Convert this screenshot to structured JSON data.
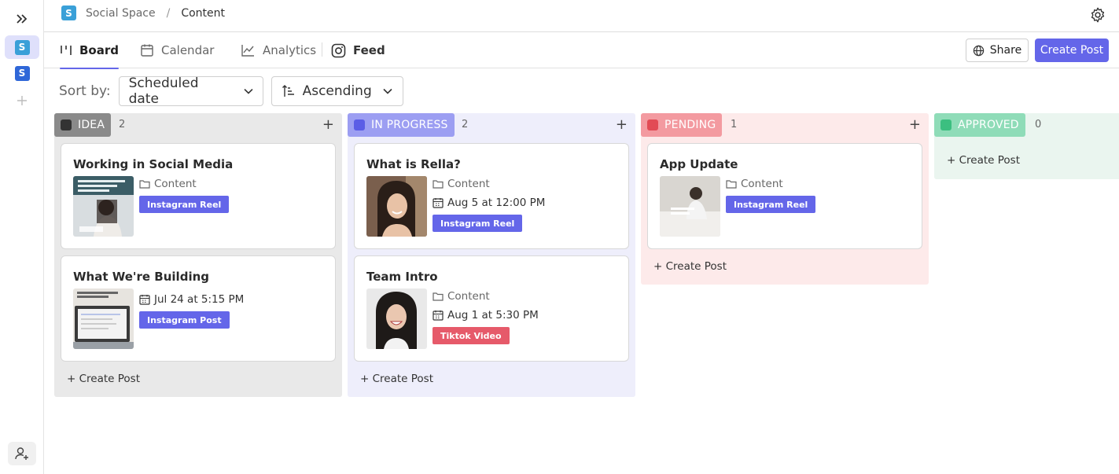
{
  "rail": {
    "workspaces": [
      {
        "letter": "S",
        "color": "#3aa0d8",
        "active": true
      },
      {
        "letter": "S",
        "color": "#2f67d8",
        "active": false
      }
    ]
  },
  "breadcrumb": {
    "workspace": "Social Space",
    "separator": "/",
    "current": "Content"
  },
  "tabs": [
    {
      "label": "Board",
      "icon": "board-icon",
      "active": true
    },
    {
      "label": "Calendar",
      "icon": "calendar-icon",
      "active": false
    },
    {
      "label": "Analytics",
      "icon": "analytics-icon",
      "active": false
    },
    {
      "label": "Feed",
      "icon": "instagram-icon",
      "active": false
    }
  ],
  "toolbar": {
    "share_label": "Share",
    "create_label": "Create Post"
  },
  "sort": {
    "label": "Sort by:",
    "field": "Scheduled date",
    "order": "Ascending"
  },
  "colors": {
    "accent": "#6466e9",
    "reel_tag": "#6466e9",
    "tiktok_tag": "#e65a6a"
  },
  "columns": [
    {
      "name": "IDEA",
      "count": "2",
      "head_color": "#8a8a8a",
      "square": "#333333",
      "bg": "#e9e9e9",
      "cards": [
        {
          "title": "Working in Social Media",
          "folder": "Content",
          "date": "",
          "tag": "Instagram Reel",
          "tag_color": "#6466e9"
        },
        {
          "title": "What We're Building",
          "folder": "",
          "date": "Jul 24 at 5:15 PM",
          "tag": "Instagram Post",
          "tag_color": "#6466e9"
        }
      ],
      "add_label": "+ Create Post"
    },
    {
      "name": "IN PROGRESS",
      "count": "2",
      "head_color": "#9c9ef2",
      "square": "#5b5de6",
      "bg": "#eeeefb",
      "cards": [
        {
          "title": "What is Rella?",
          "folder": "Content",
          "date": "Aug 5 at 12:00 PM",
          "tag": "Instagram Reel",
          "tag_color": "#6466e9"
        },
        {
          "title": "Team Intro",
          "folder": "Content",
          "date": "Aug 1 at 5:30 PM",
          "tag": "Tiktok Video",
          "tag_color": "#e65a6a"
        }
      ],
      "add_label": "+ Create Post"
    },
    {
      "name": "PENDING",
      "count": "1",
      "head_color": "#f39aa0",
      "square": "#e24b55",
      "bg": "#fdeaea",
      "cards": [
        {
          "title": "App Update",
          "folder": "Content",
          "date": "",
          "tag": "Instagram Reel",
          "tag_color": "#6466e9"
        }
      ],
      "add_label": "+ Create Post"
    },
    {
      "name": "APPROVED",
      "count": "0",
      "head_color": "#8fdcb8",
      "square": "#3cbf80",
      "bg": "#eaf5ef",
      "cards": [],
      "add_label": "+ Create Post"
    }
  ]
}
